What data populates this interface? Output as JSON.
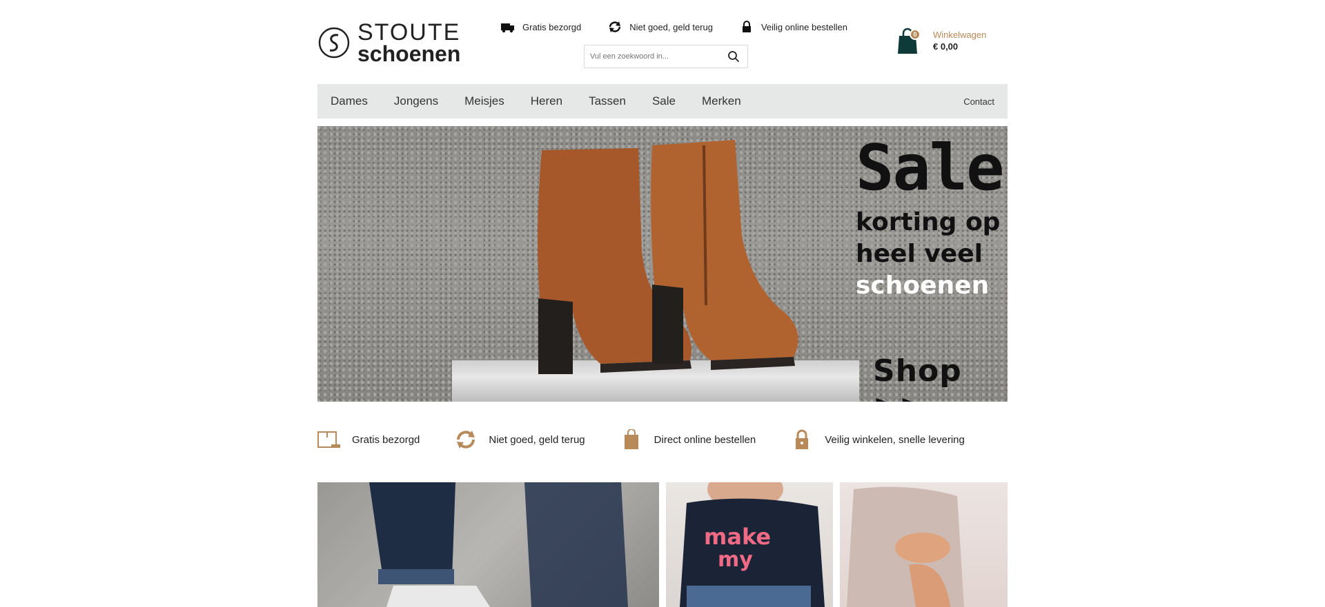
{
  "brand": {
    "top": "STOUTE",
    "bottom": "schoenen"
  },
  "top_usps": [
    {
      "label": "Gratis bezorgd",
      "icon": "truck-icon"
    },
    {
      "label": "Niet goed, geld terug",
      "icon": "refresh-icon"
    },
    {
      "label": "Veilig online bestellen",
      "icon": "lock-icon"
    }
  ],
  "search": {
    "placeholder": "Vul een zoekwoord in..."
  },
  "cart": {
    "label": "Winkelwagen",
    "amount": "€ 0,00",
    "count": "0"
  },
  "nav": {
    "items": [
      "Dames",
      "Jongens",
      "Meisjes",
      "Heren",
      "Tassen",
      "Sale",
      "Merken"
    ],
    "contact": "Contact"
  },
  "hero": {
    "title": "Sale",
    "line1": "korting op",
    "line2": "heel veel",
    "line3": "schoenen",
    "cta": "Shop  >>"
  },
  "bottom_usps": [
    {
      "label": "Gratis bezorgd",
      "icon": "box-icon"
    },
    {
      "label": "Niet goed, geld terug",
      "icon": "refresh-icon"
    },
    {
      "label": "Direct online bestellen",
      "icon": "bag-icon"
    },
    {
      "label": "Veilig winkelen, snelle levering",
      "icon": "lock-icon"
    }
  ],
  "colors": {
    "accent": "#b88a5a",
    "nav_bg": "#e6e8e7",
    "cart_icon": "#0f3a3a"
  }
}
